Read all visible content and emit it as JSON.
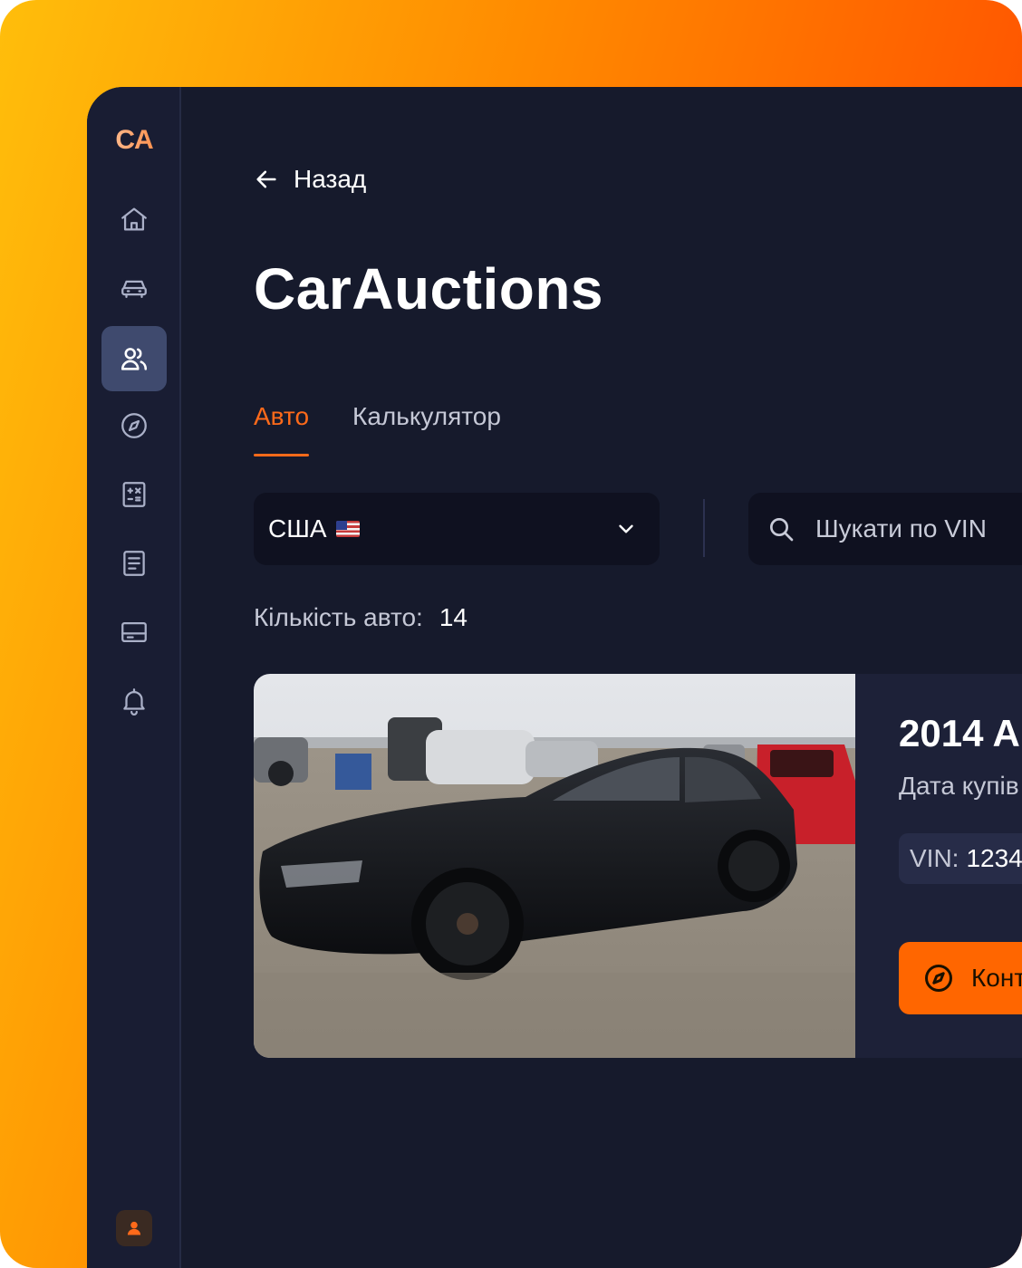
{
  "brand": {
    "logo_text": "CA"
  },
  "sidebar": {
    "items": [
      {
        "name": "home",
        "icon": "home-icon"
      },
      {
        "name": "cars",
        "icon": "car-icon"
      },
      {
        "name": "users",
        "icon": "users-icon",
        "active": true
      },
      {
        "name": "explore",
        "icon": "compass-icon"
      },
      {
        "name": "calculator",
        "icon": "calculator-icon"
      },
      {
        "name": "documents",
        "icon": "document-icon"
      },
      {
        "name": "payments",
        "icon": "card-icon"
      },
      {
        "name": "notifications",
        "icon": "bell-icon"
      }
    ],
    "profile_icon": "user-icon"
  },
  "header": {
    "back_label": "Назад",
    "title": "CarAuctions"
  },
  "tabs": [
    {
      "label": "Авто",
      "active": true
    },
    {
      "label": "Калькулятор",
      "active": false
    }
  ],
  "filters": {
    "country": {
      "value": "США",
      "flag": "🇺🇸"
    },
    "search": {
      "placeholder": "Шукати по VIN",
      "value": ""
    }
  },
  "count": {
    "label": "Кількість авто:",
    "value": "14"
  },
  "cars": [
    {
      "title": "2014 A",
      "buy_date_label": "Дата купів",
      "vin_label": "VIN:",
      "vin_value": "1234",
      "contact_label": "Конт"
    }
  ],
  "colors": {
    "accent": "#ff6600",
    "background": "#161a2c",
    "sidebar": "#191d33",
    "active_nav": "#3f4a6e"
  }
}
